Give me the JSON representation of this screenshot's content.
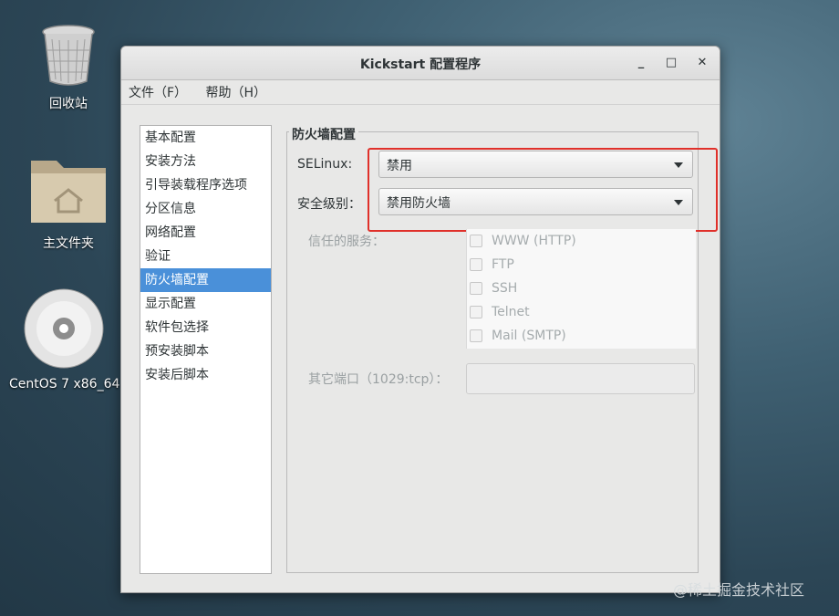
{
  "desktop": {
    "icons": [
      {
        "label": "回收站"
      },
      {
        "label": "主文件夹"
      },
      {
        "label": "CentOS 7 x86_64"
      }
    ]
  },
  "window": {
    "title": "Kickstart 配置程序",
    "controls": {
      "minimize": "_",
      "maximize": "□",
      "close": "✕"
    }
  },
  "menubar": {
    "items": [
      {
        "label": "文件（F）"
      },
      {
        "label": "帮助（H）"
      }
    ]
  },
  "sidebar": {
    "selected_index": 6,
    "items": [
      {
        "label": "基本配置"
      },
      {
        "label": "安装方法"
      },
      {
        "label": "引导装载程序选项"
      },
      {
        "label": "分区信息"
      },
      {
        "label": "网络配置"
      },
      {
        "label": "验证"
      },
      {
        "label": "防火墙配置"
      },
      {
        "label": "显示配置"
      },
      {
        "label": "软件包选择"
      },
      {
        "label": "预安装脚本"
      },
      {
        "label": "安装后脚本"
      }
    ]
  },
  "firewall": {
    "group_title": "防火墙配置",
    "selinux": {
      "label": "SELinux:",
      "value": "禁用"
    },
    "security_level": {
      "label": "安全级别：",
      "value": "禁用防火墙"
    },
    "trusted_services": {
      "label": "信任的服务：",
      "items": [
        {
          "label": "WWW (HTTP)",
          "checked": false
        },
        {
          "label": "FTP",
          "checked": false
        },
        {
          "label": "SSH",
          "checked": false
        },
        {
          "label": "Telnet",
          "checked": false
        },
        {
          "label": "Mail (SMTP)",
          "checked": false
        }
      ]
    },
    "other_ports": {
      "label": "其它端口（1029:tcp）：",
      "value": ""
    }
  },
  "watermark": "@稀土掘金技术社区",
  "colors": {
    "selection": "#4a90d9",
    "highlight_box": "#e0302a"
  }
}
